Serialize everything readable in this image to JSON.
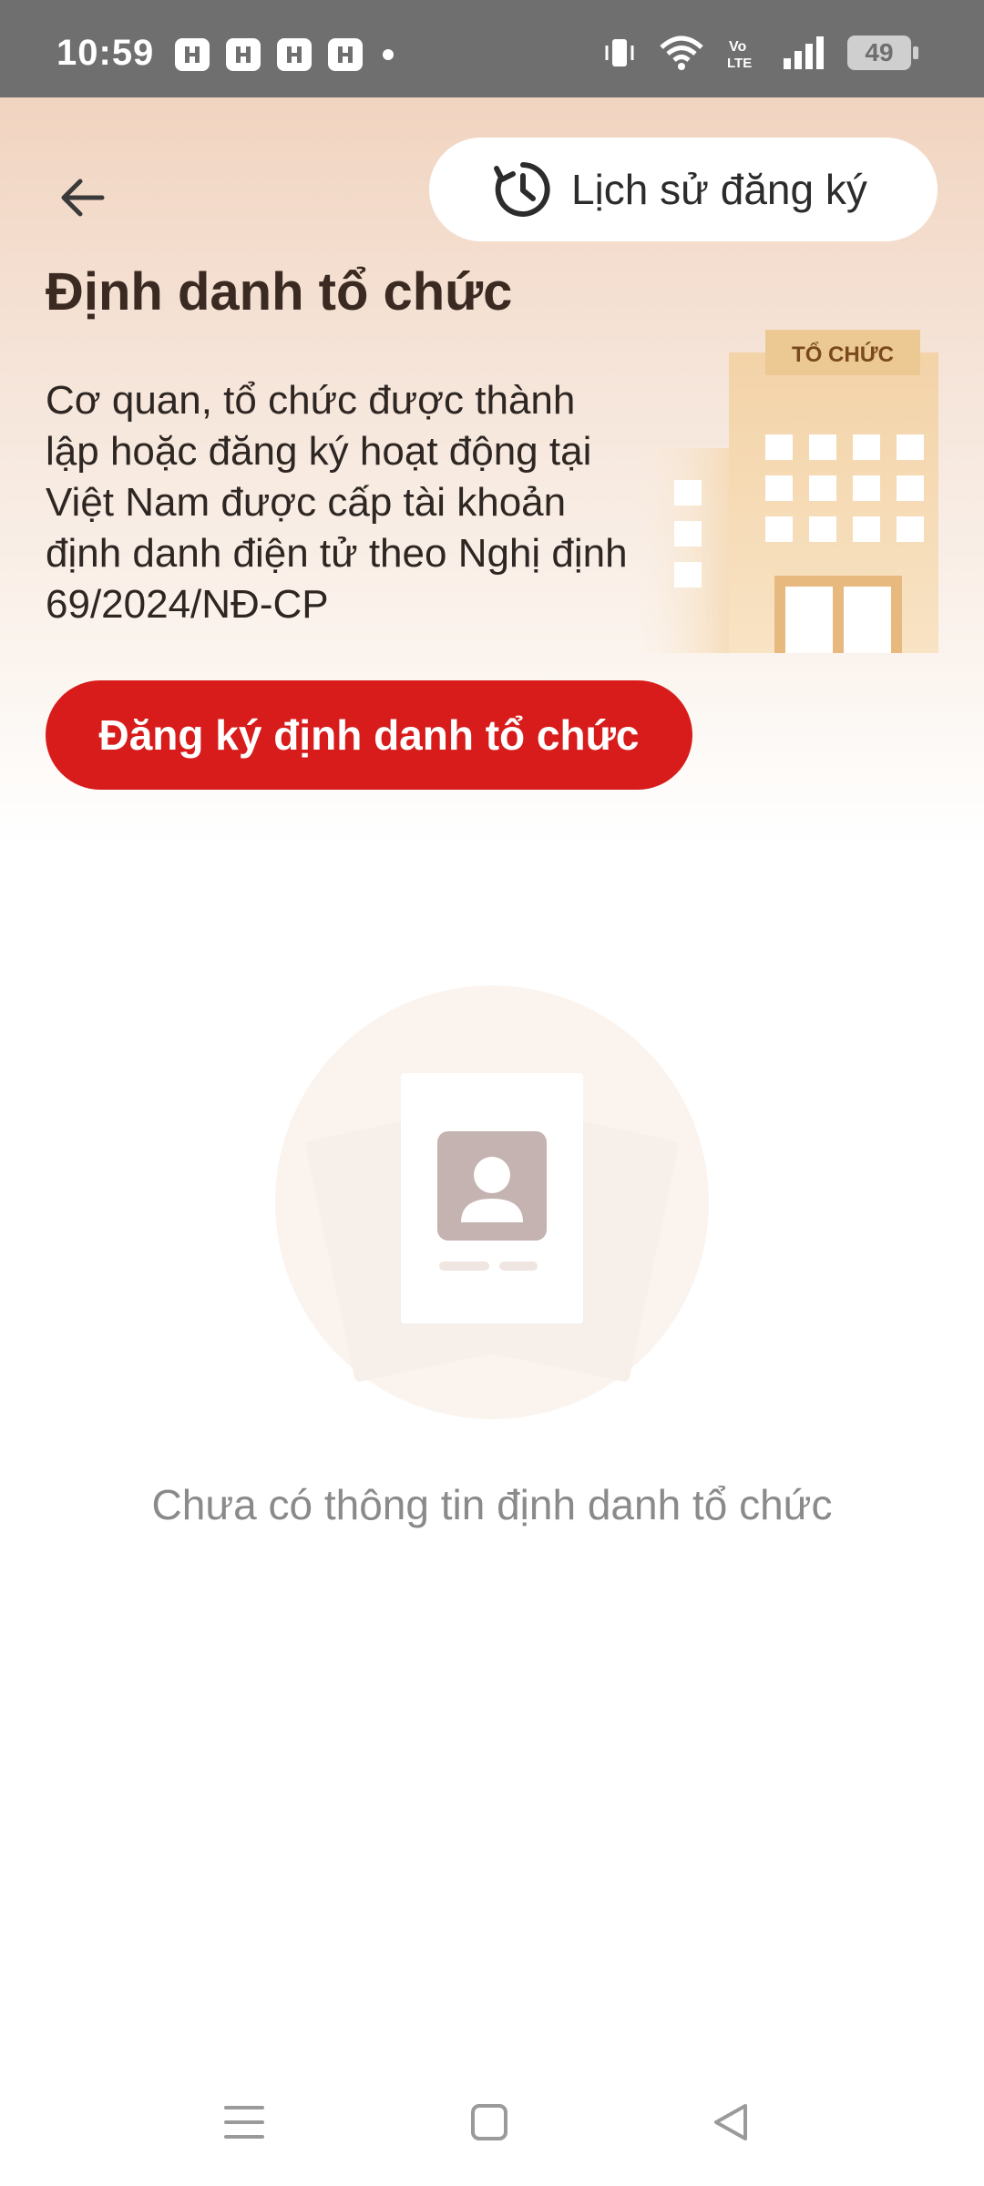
{
  "status_bar": {
    "time": "10:59",
    "battery": "49",
    "notification_icons": [
      "h-app-icon",
      "h-app-icon",
      "h-app-icon",
      "h-app-icon"
    ]
  },
  "header": {
    "back_icon": "arrow-left-icon",
    "history_button_label": "Lịch sử đăng ký",
    "history_icon": "clock-history-icon",
    "title": "Định danh tổ chức",
    "description": "Cơ quan, tổ chức được thành lập hoặc đăng ký hoạt động tại Việt Nam được cấp tài khoản định danh điện tử theo Nghị định 69/2024/NĐ-CP",
    "building_sign": "TỔ CHỨC",
    "register_button_label": "Đăng ký định danh tổ chức"
  },
  "empty_state": {
    "message": "Chưa có thông tin định danh tổ chức"
  },
  "nav_bar": {
    "items": [
      "menu-icon",
      "home-square-icon",
      "back-triangle-icon"
    ]
  },
  "colors": {
    "accent_red": "#d81c1c",
    "header_gradient_top": "#f1d4c0",
    "status_bar": "#6f6f6f"
  }
}
